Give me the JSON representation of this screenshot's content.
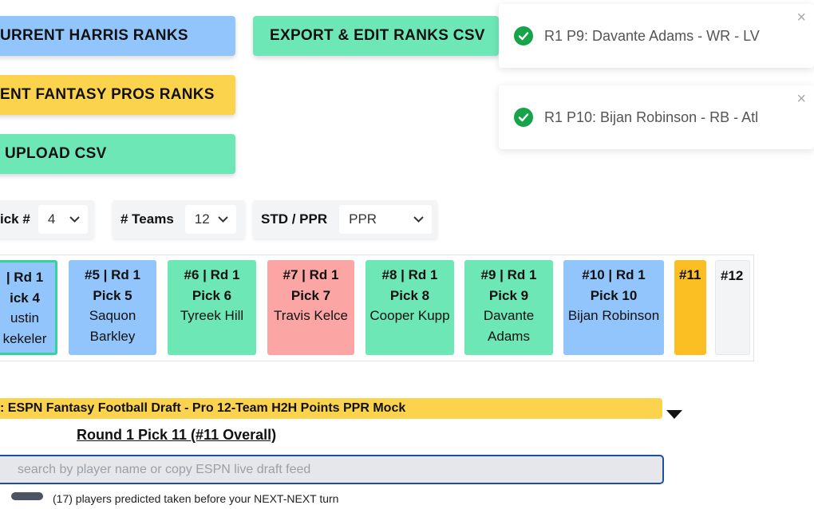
{
  "buttons": {
    "harris": "URRENT HARRIS RANKS",
    "export": "EXPORT & EDIT RANKS CSV",
    "fantasy_pros": "ENT FANTASY PROS RANKS",
    "upload": "UPLOAD CSV"
  },
  "toasts": [
    {
      "message": "R1 P9: Davante Adams - WR - LV",
      "close": "×"
    },
    {
      "message": "R1 P10: Bijan Robinson - RB - Atl",
      "close": "×"
    }
  ],
  "settings": {
    "pick_label": "ick #",
    "pick_value": "4",
    "teams_label": "# Teams",
    "teams_value": "12",
    "scoring_label": "STD / PPR",
    "scoring_value": "PPR"
  },
  "picks": [
    {
      "header": "| Rd 1",
      "pick": "ick 4",
      "player": "ustin kekeler"
    },
    {
      "header": "#5 | Rd 1",
      "pick": "Pick 5",
      "player": "Saquon Barkley"
    },
    {
      "header": "#6 | Rd 1",
      "pick": "Pick 6",
      "player": "Tyreek Hill"
    },
    {
      "header": "#7 | Rd 1",
      "pick": "Pick 7",
      "player": "Travis Kelce"
    },
    {
      "header": "#8 | Rd 1",
      "pick": "Pick 8",
      "player": "Cooper Kupp"
    },
    {
      "header": "#9 | Rd 1",
      "pick": "Pick 9",
      "player": "Davante Adams"
    },
    {
      "header": "#10 | Rd 1",
      "pick": "Pick 10",
      "player": "Bijan Robinson"
    },
    {
      "header": "#11"
    },
    {
      "header": "#12"
    }
  ],
  "draft": {
    "title": ": ESPN Fantasy Football Draft - Pro 12-Team H2H Points PPR Mock",
    "round_label": "Round 1 Pick 11 (#11 Overall)",
    "search_placeholder": "search by player name or copy ESPN live draft feed",
    "predicted_note": "(17) players predicted taken before your NEXT-NEXT turn"
  },
  "colors": {
    "blue": "#93c5fd",
    "yellow": "#fcd34d",
    "green": "#6ee7b7",
    "red": "#fca5a5",
    "orange": "#fbbf24",
    "empty": "#f3f4f6",
    "check": "#16a34a"
  }
}
